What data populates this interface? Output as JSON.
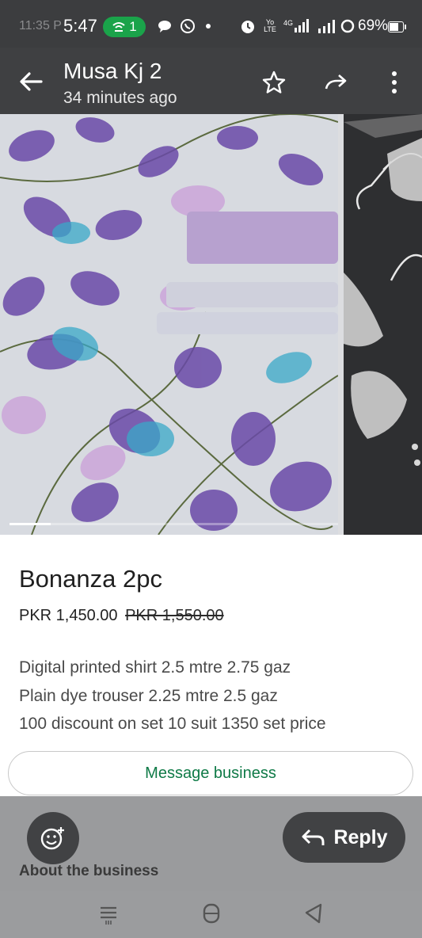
{
  "status_bar": {
    "ghost_time": "11:35 P",
    "time": "5:47",
    "hotspot_count": "1",
    "volte": "Yo LTE",
    "network": "4G",
    "battery": "69%",
    "battery_level": 0.69,
    "icons": [
      "wifi-hotspot-icon",
      "chat-bubble-icon",
      "whatsapp-icon",
      "dot-icon",
      "alarm-icon",
      "signal-icon",
      "signal-icon",
      "data-saver-icon",
      "battery-icon"
    ]
  },
  "header": {
    "title": "Musa Kj 2",
    "subtitle": "34 minutes ago",
    "icons": [
      "back-arrow-icon",
      "star-icon",
      "forward-icon",
      "more-vert-icon"
    ]
  },
  "gallery": {
    "image_count": 2,
    "current_index": 1
  },
  "product": {
    "title": "Bonanza 2pc",
    "price": "PKR 1,450.00",
    "old_price": "PKR 1,550.00",
    "description": [
      "Digital printed shirt 2.5 mtre 2.75 gaz",
      "Plain dye trouser 2.25 mtre 2.5 gaz",
      "100 discount on set 10 suit 1350 set price"
    ],
    "message_button": "Message business"
  },
  "overlay": {
    "about_label": "About the business",
    "reply_label": "Reply",
    "fab_icon": "emoji-add-icon"
  },
  "nav": {
    "icons": [
      "recents-icon",
      "home-icon",
      "back-icon"
    ]
  },
  "colors": {
    "status_bar": "#3c3d3f",
    "app_bar": "#3f4042",
    "accent_green": "#0f7a47",
    "hotspot_green": "#1aa34a",
    "overlay": "#9a9b9d"
  }
}
